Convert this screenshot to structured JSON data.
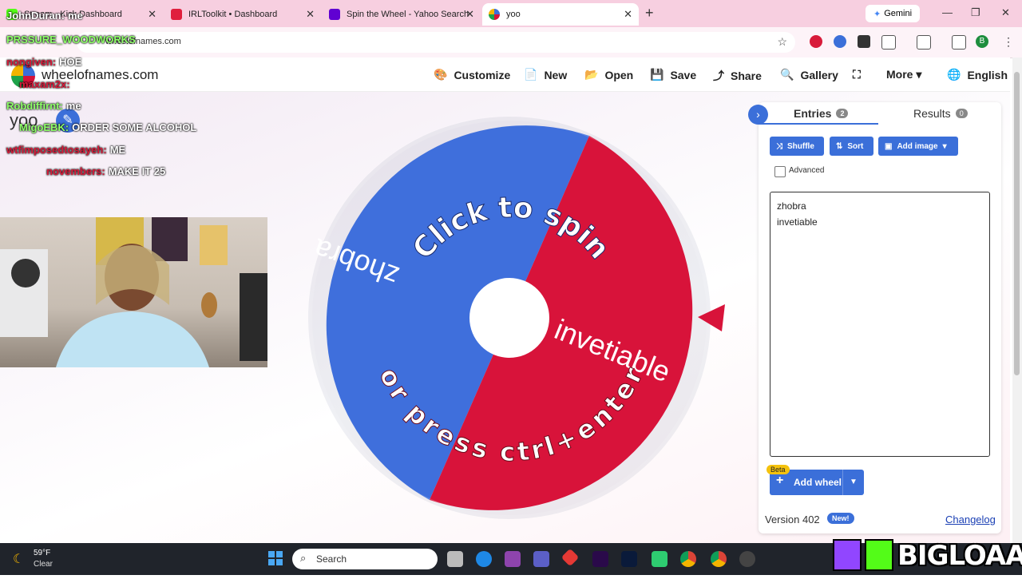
{
  "browser": {
    "tabs": [
      {
        "title": "Stream - Kick Dashboard",
        "color": "#53fc18"
      },
      {
        "title": "IRLToolkit • Dashboard",
        "color": "#e01f3d"
      },
      {
        "title": "Spin the Wheel - Yahoo Search",
        "color": "#6001d2"
      },
      {
        "title": "yoo",
        "color": "#3b6fd9"
      }
    ],
    "new_tab": "+",
    "close": "✕",
    "gemini_label": "Gemini",
    "url": "wheelofnames.com",
    "profile_initial": "B"
  },
  "site": {
    "name": "wheelofnames.com",
    "nav": [
      {
        "label": "Customize",
        "icon": "🎨"
      },
      {
        "label": "New",
        "icon": "📄"
      },
      {
        "label": "Open",
        "icon": "📂"
      },
      {
        "label": "Save",
        "icon": "💾"
      },
      {
        "label": "Share",
        "icon": "⤴"
      },
      {
        "label": "Gallery",
        "icon": "🔍"
      },
      {
        "label": "More ▾",
        "icon": ""
      },
      {
        "label": "English",
        "icon": "🌐"
      }
    ],
    "fullscreen_icon": "⛶"
  },
  "wheel": {
    "title": "yoo",
    "top_text": "Click to spin",
    "bottom_text": "or press ctrl+enter",
    "segments": [
      {
        "label": "zhobra",
        "color": "#3f6fdc"
      },
      {
        "label": "invetiable",
        "color": "#d8133a"
      }
    ]
  },
  "chat": [
    {
      "user": "JohnDuran:",
      "msg": "me",
      "color": "#ffffff"
    },
    {
      "user": "PRSSURE_WOODWORKS",
      "msg": "",
      "color": "#8fff6a"
    },
    {
      "user": "nongiven:",
      "msg": "HOE",
      "color": "#d81b3a"
    },
    {
      "user": "maxam2x:",
      "msg": "",
      "color": "#d81b3a"
    },
    {
      "user": "Robdiffirnt:",
      "msg": "me",
      "color": "#8fff6a"
    },
    {
      "user": "MigoEBK:",
      "msg": "ORDER SOME ALCOHOL",
      "color": "#8fff6a"
    },
    {
      "user": "wtfimposedtosayeh:",
      "msg": "ME",
      "color": "#d81b3a"
    },
    {
      "user": "novembers:",
      "msg": "MAKE IT 25",
      "color": "#d81b3a"
    }
  ],
  "panel": {
    "tab_entries": "Entries",
    "entries_count": "2",
    "tab_results": "Results",
    "results_count": "0",
    "shuffle": "Shuffle",
    "sort": "Sort",
    "add_image": "Add image",
    "advanced": "Advanced",
    "entries": [
      "zhobra",
      "invetiable"
    ],
    "beta": "Beta",
    "add_wheel": "Add wheel",
    "version": "Version 402",
    "new_badge": "New!",
    "changelog": "Changelog"
  },
  "taskbar": {
    "temp": "59°F",
    "condition": "Clear",
    "search": "Search"
  },
  "overlay": {
    "brand": "BIGLOAAF"
  }
}
